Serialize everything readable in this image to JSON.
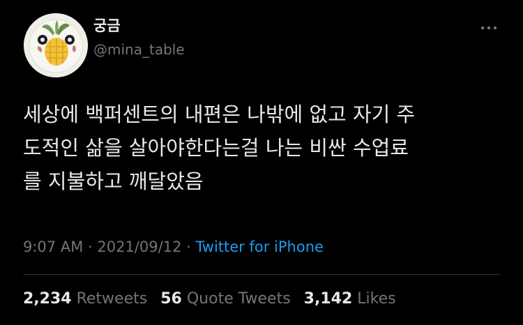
{
  "user": {
    "display_name": "궁금",
    "handle": "@mina_table",
    "avatar_icon": "avatar-plate-pineapple-icon"
  },
  "menu": {
    "icon": "more-horizontal-icon",
    "symbol": "···"
  },
  "tweet": {
    "lines": [
      "세상에 백퍼센트의 내편은 나밖에 없고 자기 주",
      "도적인 삶을 살아야한다는걸 나는 비싼 수업료",
      "를 지불하고 깨달았음"
    ]
  },
  "meta": {
    "time": "9:07 AM",
    "separator": " · ",
    "date": "2021/09/12",
    "separator2": " · ",
    "source": "Twitter for iPhone"
  },
  "stats": {
    "retweets_count": "2,234",
    "retweets_label": "Retweets",
    "quotes_count": "56",
    "quotes_label": "Quote Tweets",
    "likes_count": "3,142",
    "likes_label": "Likes"
  },
  "colors": {
    "background": "#000000",
    "text_primary": "#e7e9ea",
    "text_secondary": "#71767b",
    "link": "#1d9bf0",
    "divider": "#2f3336"
  }
}
